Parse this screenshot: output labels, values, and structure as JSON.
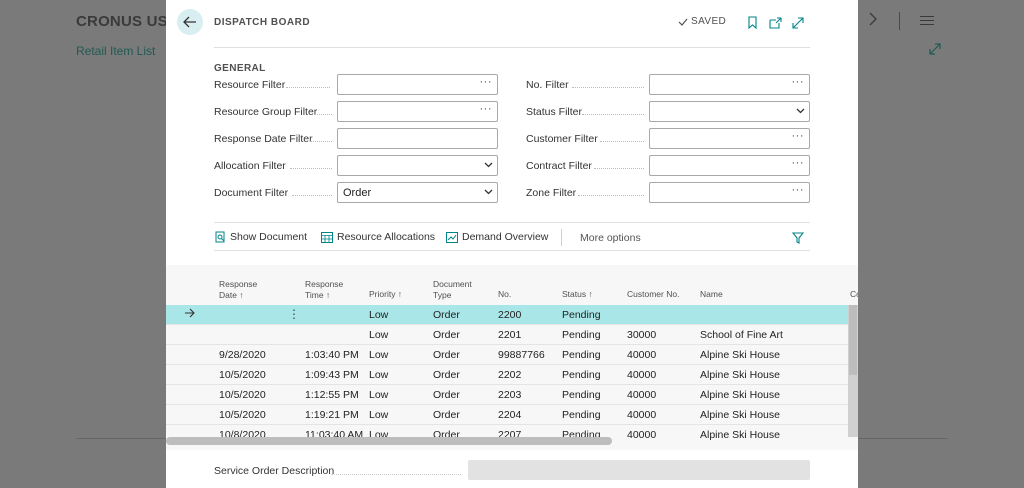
{
  "background": {
    "company": "CRONUS USA",
    "link": "Retail Item List",
    "nav_partial": "t"
  },
  "dialog": {
    "title": "DISPATCH BOARD",
    "saved_label": "SAVED"
  },
  "general": {
    "header": "GENERAL",
    "left_fields": [
      {
        "label": "Resource Filter",
        "value": "",
        "control": "lookup"
      },
      {
        "label": "Resource Group Filter",
        "value": "",
        "control": "lookup"
      },
      {
        "label": "Response Date Filter",
        "value": "",
        "control": "text"
      },
      {
        "label": "Allocation Filter",
        "value": "",
        "control": "select"
      },
      {
        "label": "Document Filter",
        "value": "Order",
        "control": "select"
      }
    ],
    "right_fields": [
      {
        "label": "No. Filter",
        "value": "",
        "control": "lookup"
      },
      {
        "label": "Status Filter",
        "value": "",
        "control": "select"
      },
      {
        "label": "Customer Filter",
        "value": "",
        "control": "lookup"
      },
      {
        "label": "Contract Filter",
        "value": "",
        "control": "lookup"
      },
      {
        "label": "Zone Filter",
        "value": "",
        "control": "lookup"
      }
    ]
  },
  "actions": {
    "show_document": "Show Document",
    "resource_allocations": "Resource Allocations",
    "demand_overview": "Demand Overview",
    "more_options": "More options"
  },
  "grid": {
    "headers": {
      "response_date_1": "Response",
      "response_date_2": "Date ↑",
      "response_time_1": "Response",
      "response_time_2": "Time ↑",
      "priority": "Priority ↑",
      "document_type_1": "Document",
      "document_type_2": "Type",
      "no": "No.",
      "status": "Status ↑",
      "customer_no": "Customer No.",
      "name": "Name",
      "more": "Co"
    },
    "rows": [
      {
        "date": "",
        "time": "",
        "priority": "Low",
        "doc_type": "Order",
        "no": "2200",
        "status": "Pending",
        "customer_no": "",
        "name": ""
      },
      {
        "date": "",
        "time": "",
        "priority": "Low",
        "doc_type": "Order",
        "no": "2201",
        "status": "Pending",
        "customer_no": "30000",
        "name": "School of Fine Art"
      },
      {
        "date": "9/28/2020",
        "time": "1:03:40 PM",
        "priority": "Low",
        "doc_type": "Order",
        "no": "99887766",
        "status": "Pending",
        "customer_no": "40000",
        "name": "Alpine Ski House"
      },
      {
        "date": "10/5/2020",
        "time": "1:09:43 PM",
        "priority": "Low",
        "doc_type": "Order",
        "no": "2202",
        "status": "Pending",
        "customer_no": "40000",
        "name": "Alpine Ski House"
      },
      {
        "date": "10/5/2020",
        "time": "1:12:55 PM",
        "priority": "Low",
        "doc_type": "Order",
        "no": "2203",
        "status": "Pending",
        "customer_no": "40000",
        "name": "Alpine Ski House"
      },
      {
        "date": "10/5/2020",
        "time": "1:19:21 PM",
        "priority": "Low",
        "doc_type": "Order",
        "no": "2204",
        "status": "Pending",
        "customer_no": "40000",
        "name": "Alpine Ski House"
      },
      {
        "date": "10/8/2020",
        "time": "11:03:40 AM",
        "priority": "Low",
        "doc_type": "Order",
        "no": "2207",
        "status": "Pending",
        "customer_no": "40000",
        "name": "Alpine Ski House"
      }
    ]
  },
  "footer": {
    "service_order_description_label": "Service Order Description",
    "service_order_description_value": ""
  },
  "colors": {
    "accent": "#008489",
    "selected_row": "#a8e6e8",
    "back_button_bg": "#d9eef0"
  }
}
